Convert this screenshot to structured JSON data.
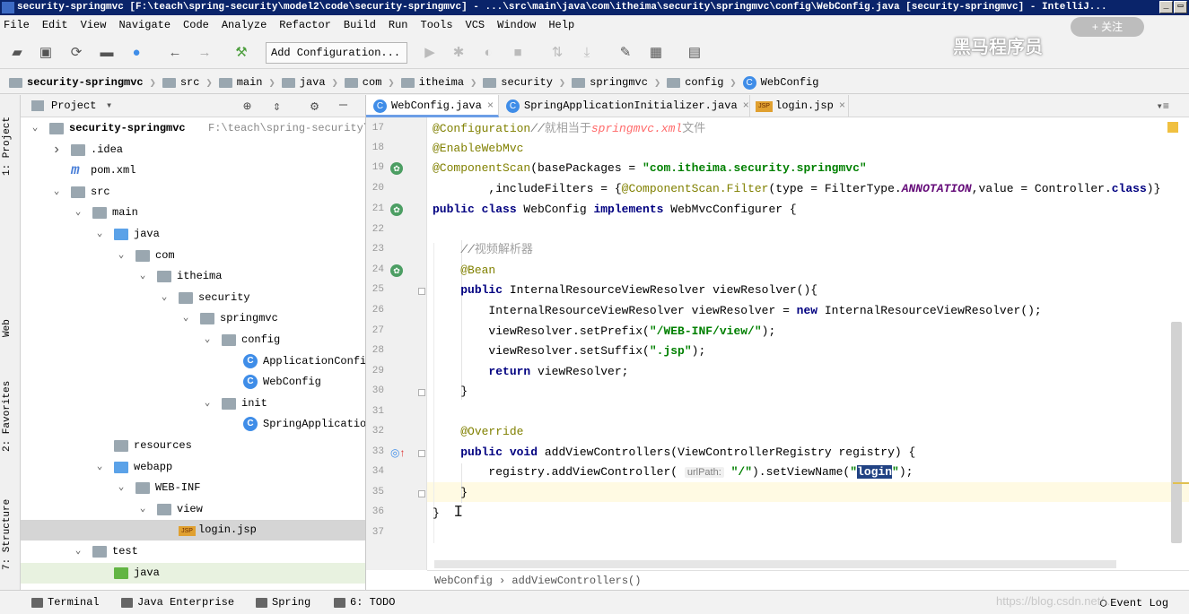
{
  "window": {
    "title": "security-springmvc [F:\\teach\\spring-security\\model2\\code\\security-springmvc] - ...\\src\\main\\java\\com\\itheima\\security\\springmvc\\config\\WebConfig.java [security-springmvc] - IntelliJ..."
  },
  "menu": [
    "File",
    "Edit",
    "View",
    "Navigate",
    "Code",
    "Analyze",
    "Refactor",
    "Build",
    "Run",
    "Tools",
    "VCS",
    "Window",
    "Help"
  ],
  "toolbar": {
    "run_config": "Add Configuration..."
  },
  "overlay": {
    "watermark": "黑马程序员",
    "follow": "+ 关注"
  },
  "breadcrumbs": [
    "security-springmvc",
    "src",
    "main",
    "java",
    "com",
    "itheima",
    "security",
    "springmvc",
    "config",
    "WebConfig"
  ],
  "side_tabs": {
    "project": "1: Project",
    "web": "Web",
    "favorites": "2: Favorites",
    "structure": "7: Structure"
  },
  "project": {
    "header": "Project",
    "root_path": "F:\\teach\\spring-security\\mo",
    "tree": [
      {
        "label": "security-springmvc",
        "depth": 0,
        "arrow": "down",
        "icon": "folder",
        "bold": true
      },
      {
        "label": ".idea",
        "depth": 1,
        "arrow": "right",
        "icon": "folder"
      },
      {
        "label": "pom.xml",
        "depth": 1,
        "arrow": "",
        "icon": "maven"
      },
      {
        "label": "src",
        "depth": 1,
        "arrow": "down",
        "icon": "folder"
      },
      {
        "label": "main",
        "depth": 2,
        "arrow": "down",
        "icon": "folder"
      },
      {
        "label": "java",
        "depth": 3,
        "arrow": "down",
        "icon": "folder-blue"
      },
      {
        "label": "com",
        "depth": 4,
        "arrow": "down",
        "icon": "folder"
      },
      {
        "label": "itheima",
        "depth": 5,
        "arrow": "down",
        "icon": "folder"
      },
      {
        "label": "security",
        "depth": 6,
        "arrow": "down",
        "icon": "folder"
      },
      {
        "label": "springmvc",
        "depth": 7,
        "arrow": "down",
        "icon": "folder"
      },
      {
        "label": "config",
        "depth": 8,
        "arrow": "down",
        "icon": "folder"
      },
      {
        "label": "ApplicationConfig",
        "depth": 9,
        "arrow": "",
        "icon": "class"
      },
      {
        "label": "WebConfig",
        "depth": 9,
        "arrow": "",
        "icon": "class"
      },
      {
        "label": "init",
        "depth": 8,
        "arrow": "down",
        "icon": "folder"
      },
      {
        "label": "SpringApplicationInitializer",
        "depth": 9,
        "arrow": "",
        "icon": "class"
      },
      {
        "label": "resources",
        "depth": 3,
        "arrow": "",
        "icon": "folder"
      },
      {
        "label": "webapp",
        "depth": 3,
        "arrow": "down",
        "icon": "folder-blue"
      },
      {
        "label": "WEB-INF",
        "depth": 4,
        "arrow": "down",
        "icon": "folder"
      },
      {
        "label": "view",
        "depth": 5,
        "arrow": "down",
        "icon": "folder"
      },
      {
        "label": "login.jsp",
        "depth": 6,
        "arrow": "",
        "icon": "jsp",
        "selected": true
      },
      {
        "label": "test",
        "depth": 2,
        "arrow": "down",
        "icon": "folder"
      },
      {
        "label": "java",
        "depth": 3,
        "arrow": "",
        "icon": "folder-green",
        "highlight": true
      }
    ]
  },
  "tabs": [
    {
      "label": "WebConfig.java",
      "icon": "C",
      "active": true
    },
    {
      "label": "SpringApplicationInitializer.java",
      "icon": "C",
      "active": false
    },
    {
      "label": "login.jsp",
      "icon": "JSP",
      "active": false
    }
  ],
  "editor": {
    "line_numbers": [
      "17",
      "18",
      "19",
      "20",
      "21",
      "22",
      "23",
      "24",
      "25",
      "26",
      "27",
      "28",
      "29",
      "30",
      "31",
      "32",
      "33",
      "34",
      "35",
      "36",
      "37"
    ],
    "current_line": "34",
    "selected_word": "login",
    "breadcrumb": [
      "WebConfig",
      "addViewControllers()"
    ]
  },
  "statusbar": {
    "items": [
      "Terminal",
      "Java Enterprise",
      "Spring",
      "6: TODO"
    ],
    "event_log": "Event Log",
    "url_watermark": "https://blog.csdn.net/..."
  },
  "colors": {
    "accent": "#3f8de8",
    "selection": "#214283",
    "current_line": "#fffae3"
  }
}
